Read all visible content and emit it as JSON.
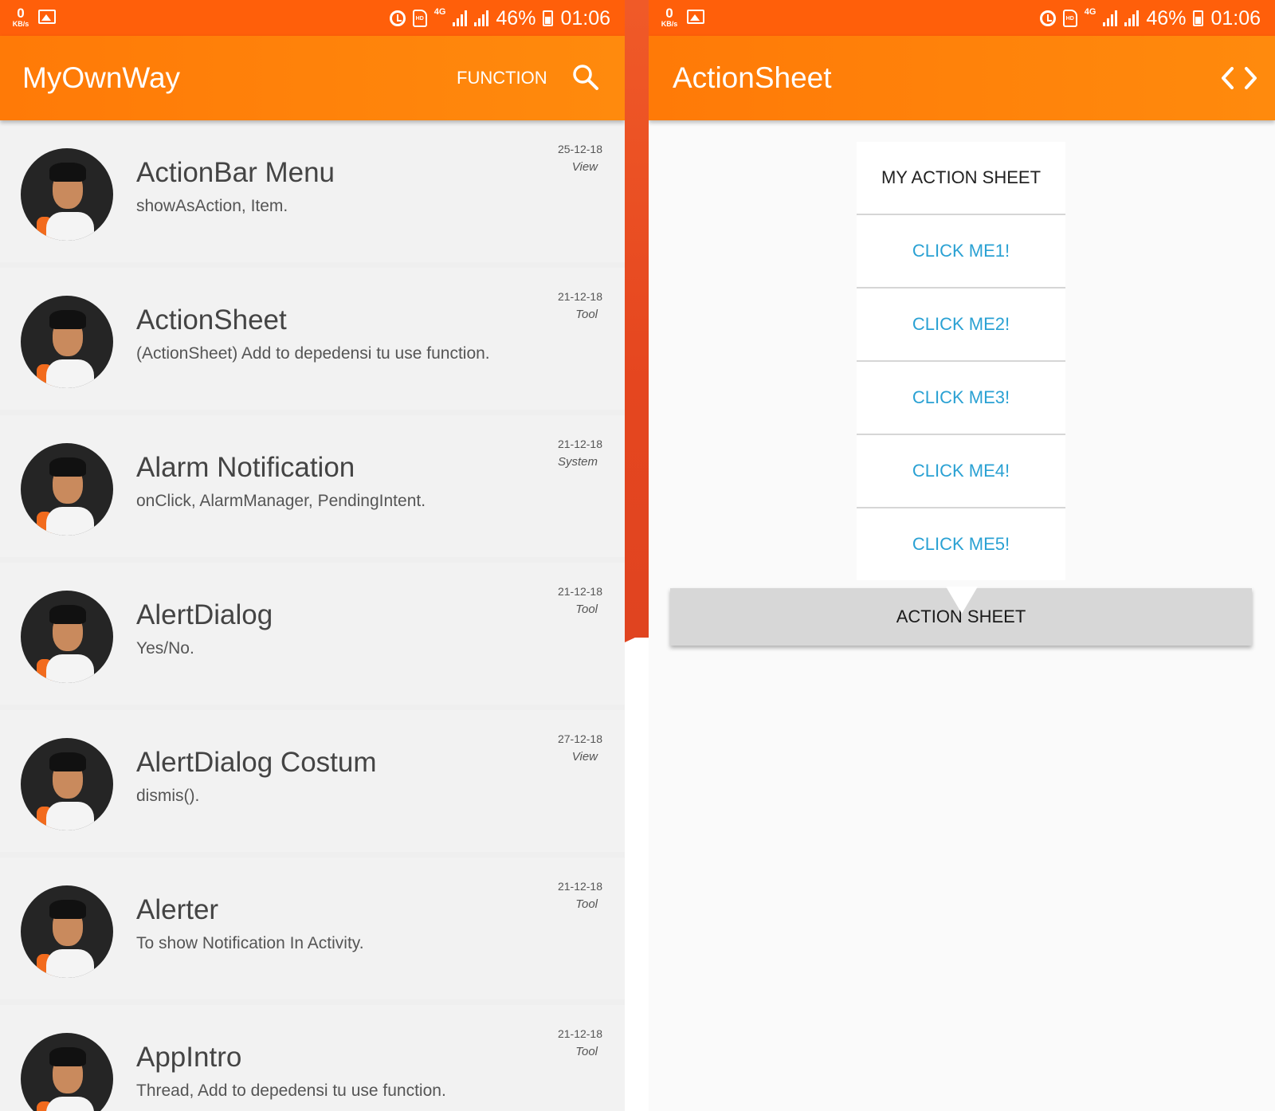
{
  "status_bar": {
    "kb_value": "0",
    "kb_unit": "KB/s",
    "network": "4G",
    "hd_label": "HD",
    "battery": "46%",
    "time": "01:06"
  },
  "left_app": {
    "title": "MyOwnWay",
    "function_label": "FUNCTION",
    "items": [
      {
        "title": "ActionBar Menu",
        "subtitle": "showAsAction, Item.",
        "date": "25-12-18",
        "category": "View"
      },
      {
        "title": "ActionSheet",
        "subtitle": "(ActionSheet) Add to depedensi tu use function.",
        "date": "21-12-18",
        "category": "Tool"
      },
      {
        "title": "Alarm Notification",
        "subtitle": "onClick, AlarmManager, PendingIntent.",
        "date": "21-12-18",
        "category": "System"
      },
      {
        "title": "AlertDialog",
        "subtitle": "Yes/No.",
        "date": "21-12-18",
        "category": "Tool"
      },
      {
        "title": "AlertDialog Costum",
        "subtitle": "dismis().",
        "date": "27-12-18",
        "category": "View"
      },
      {
        "title": "Alerter",
        "subtitle": "To show Notification In Activity.",
        "date": "21-12-18",
        "category": "Tool"
      },
      {
        "title": "AppIntro",
        "subtitle": "Thread, Add to depedensi tu use function.",
        "date": "21-12-18",
        "category": "Tool"
      }
    ]
  },
  "right_app": {
    "title": "ActionSheet",
    "sheet_header": "MY ACTION SHEET",
    "options": [
      "CLICK ME1!",
      "CLICK ME2!",
      "CLICK ME3!",
      "CLICK ME4!",
      "CLICK ME5!"
    ],
    "action_button": "ACTION SHEET"
  },
  "colors": {
    "status_bar": "#ff5f0a",
    "toolbar": "#ff7f0a",
    "option_text": "#2aa1d3"
  }
}
